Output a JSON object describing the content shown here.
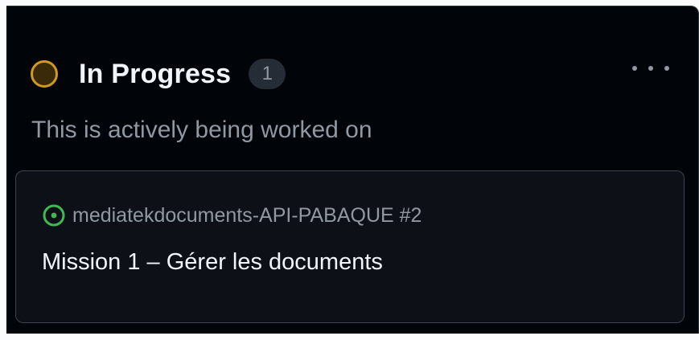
{
  "column": {
    "title": "In Progress",
    "count": "1",
    "description": "This is actively being worked on",
    "status_color": "#d29922",
    "status_icon": "circle-outline-icon",
    "menu_icon": "kebab-horizontal-icon"
  },
  "card": {
    "state_icon": "issue-opened-icon",
    "state_color": "#3fb950",
    "repo_ref": "mediatekdocuments-API-PABAQUE #2",
    "title": "Mission 1 – Gérer les documents"
  }
}
